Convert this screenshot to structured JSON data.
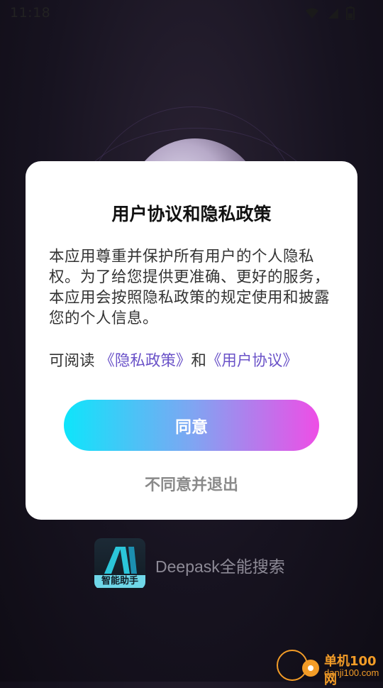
{
  "status_bar": {
    "time": "11:18",
    "icons": [
      "wifi-icon",
      "signal-icon",
      "battery-icon"
    ]
  },
  "dialog": {
    "title": "用户协议和隐私政策",
    "body": "本应用尊重并保护所有用户的个人隐私权。为了给您提供更准确、更好的服务，本应用会按照隐私政策的规定使用和披露您的个人信息。",
    "read_prefix": "可阅读 ",
    "privacy_link": "《隐私政策》",
    "conjunction": "和",
    "agreement_link": "《用户协议》",
    "agree_label": "同意",
    "decline_label": "不同意并退出"
  },
  "app": {
    "logo_caption": "智能助手",
    "name": "Deepask全能搜索"
  },
  "watermark": {
    "title": "单机100网",
    "url": "danji100.com"
  },
  "colors": {
    "link": "#6a52c8",
    "button_gradient_start": "#0ee5fb",
    "button_gradient_end": "#ee4ee6",
    "watermark": "#f39c27"
  }
}
